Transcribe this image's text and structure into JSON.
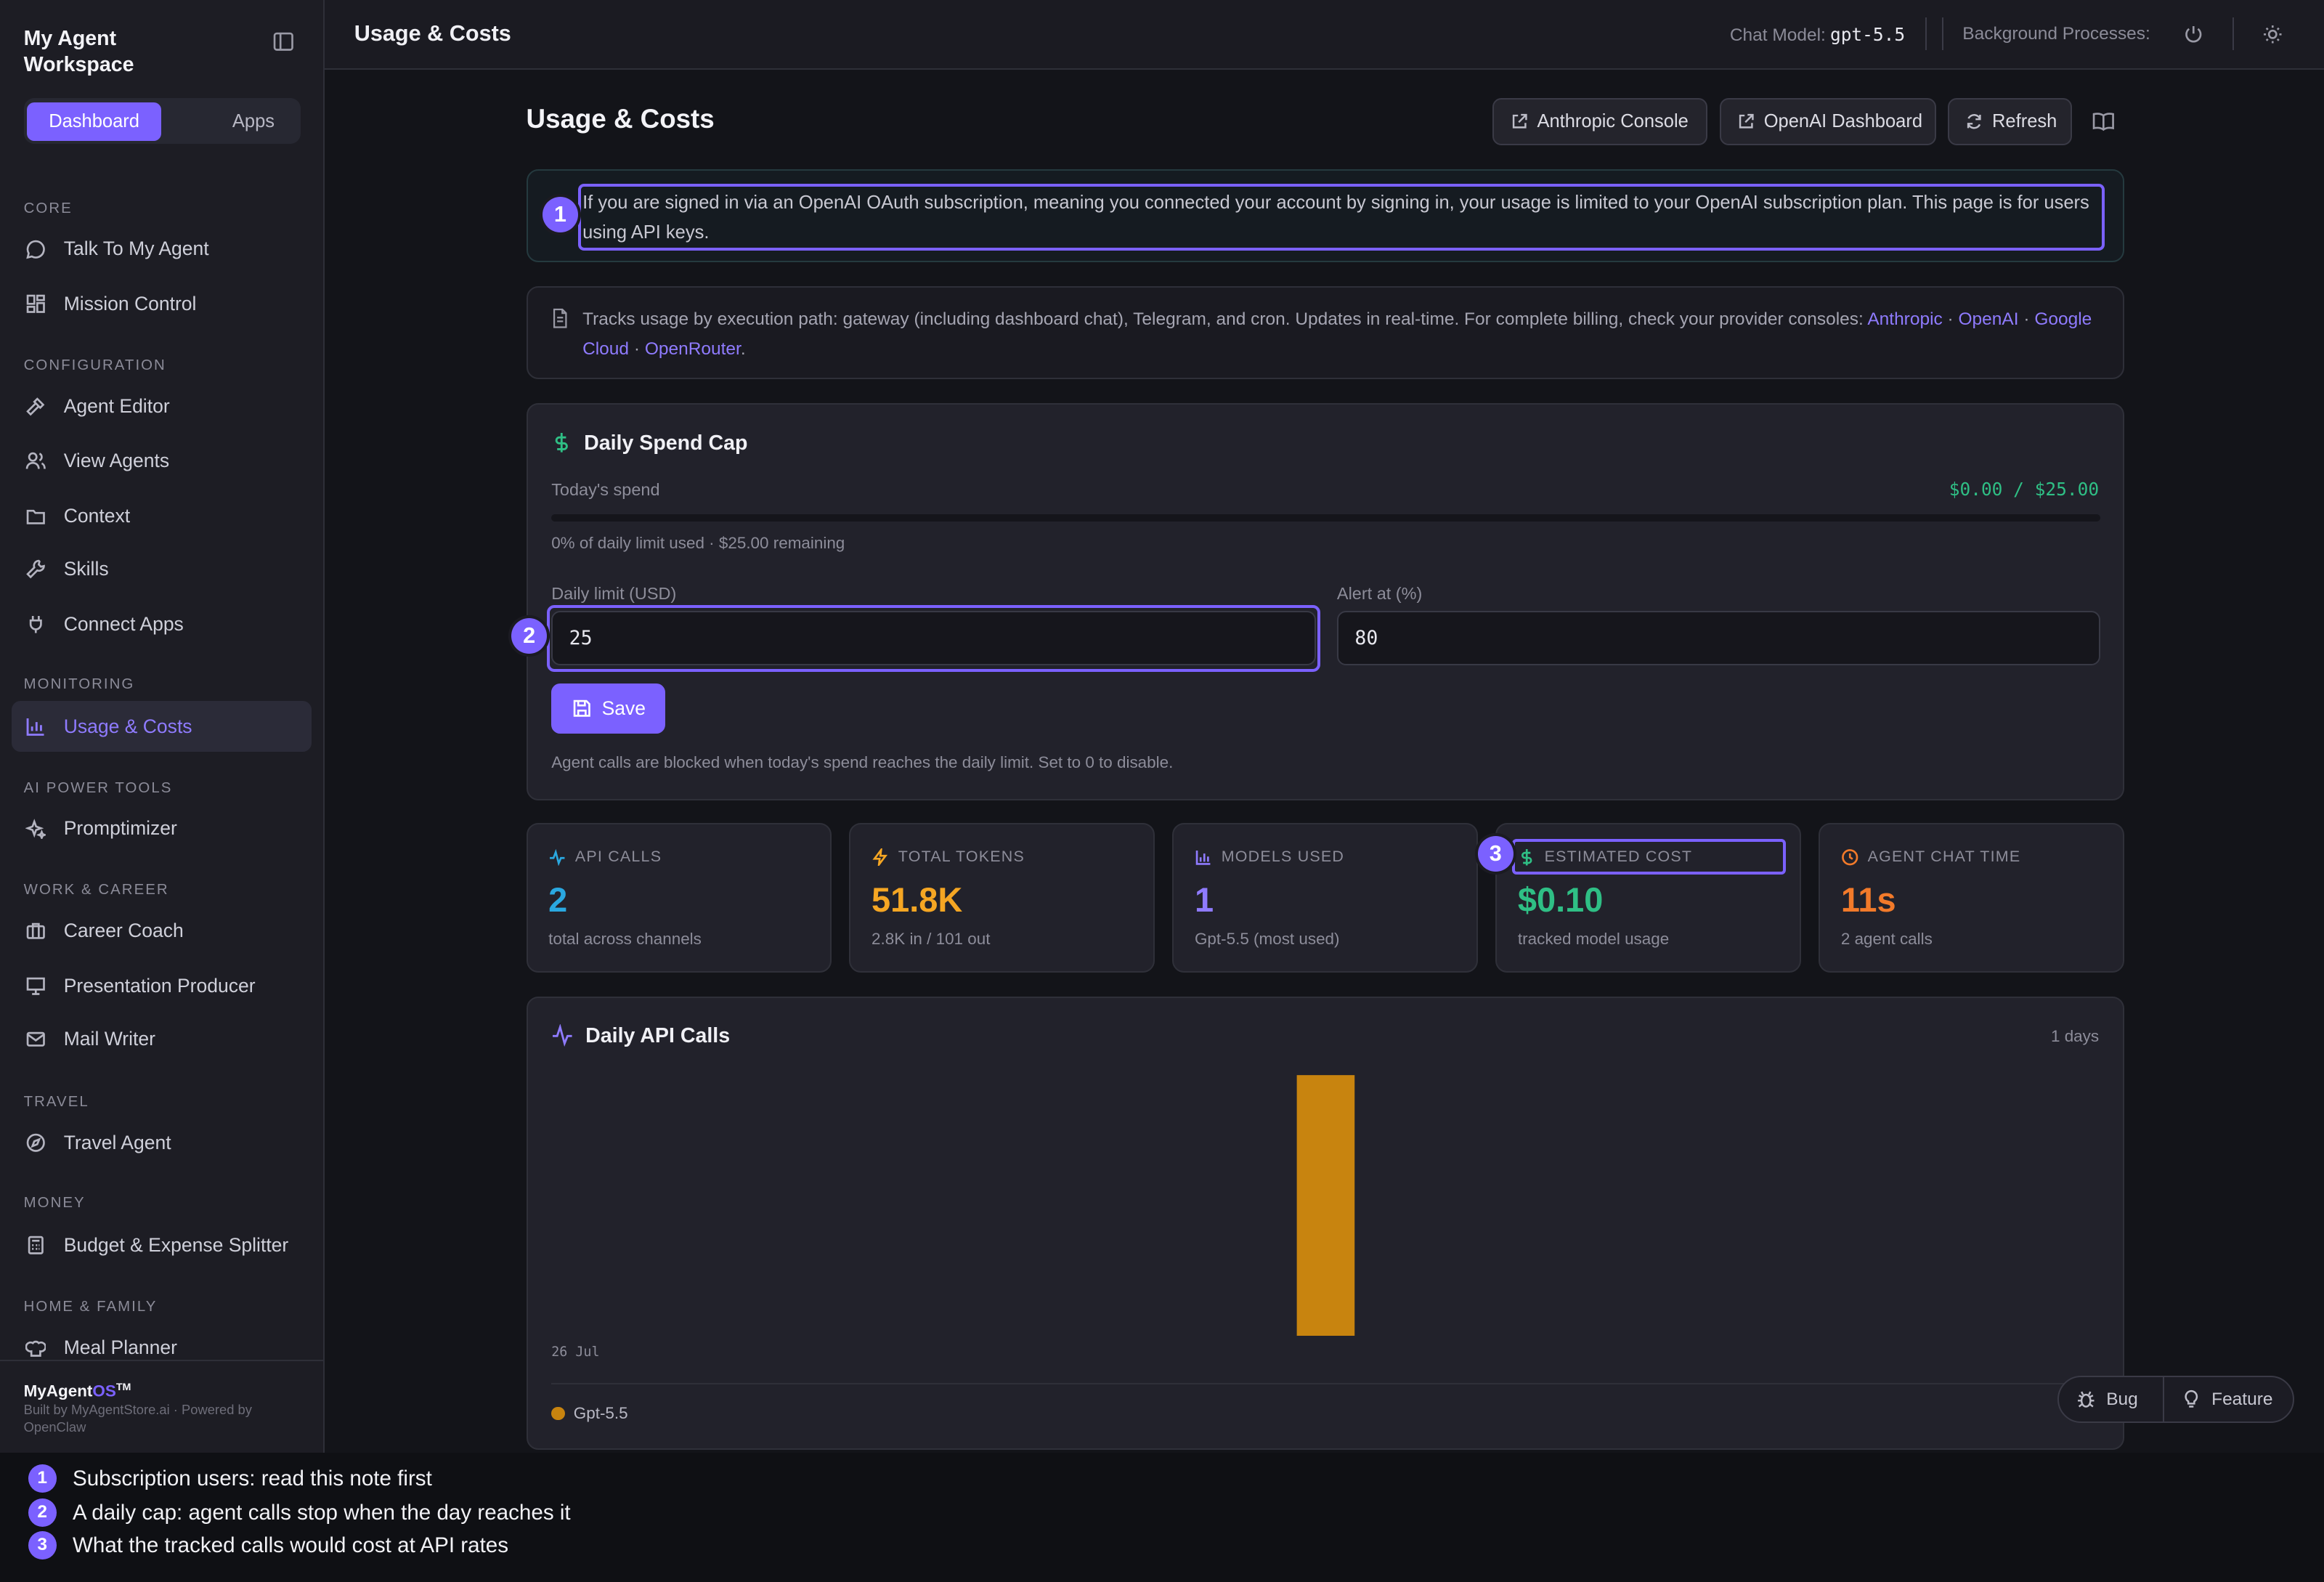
{
  "sidebar": {
    "workspace_title": "My Agent Workspace",
    "tabs": {
      "dashboard": "Dashboard",
      "apps": "Apps"
    },
    "sections": [
      {
        "label": "CORE"
      },
      {
        "label": "CONFIGURATION"
      },
      {
        "label": "MONITORING"
      },
      {
        "label": "AI POWER TOOLS"
      },
      {
        "label": "WORK & CAREER"
      },
      {
        "label": "TRAVEL"
      },
      {
        "label": "MONEY"
      },
      {
        "label": "HOME & FAMILY"
      }
    ],
    "items": [
      {
        "label": "Talk To My Agent",
        "icon": "chat-bubble-icon"
      },
      {
        "label": "Mission Control",
        "icon": "grid-icon"
      },
      {
        "label": "Agent Editor",
        "icon": "hammer-icon"
      },
      {
        "label": "View Agents",
        "icon": "users-icon"
      },
      {
        "label": "Context",
        "icon": "folder-icon"
      },
      {
        "label": "Skills",
        "icon": "wrench-icon"
      },
      {
        "label": "Connect Apps",
        "icon": "plug-icon"
      },
      {
        "label": "Usage & Costs",
        "icon": "bar-chart-icon",
        "active": true
      },
      {
        "label": "Promptimizer",
        "icon": "sparkles-icon"
      },
      {
        "label": "Career Coach",
        "icon": "briefcase-icon"
      },
      {
        "label": "Presentation Producer",
        "icon": "presentation-icon"
      },
      {
        "label": "Mail Writer",
        "icon": "mail-icon"
      },
      {
        "label": "Travel Agent",
        "icon": "compass-icon"
      },
      {
        "label": "Budget & Expense Splitter",
        "icon": "calculator-icon"
      },
      {
        "label": "Meal Planner",
        "icon": "chef-hat-icon"
      }
    ],
    "footer": {
      "brand_main": "MyAgent",
      "brand_os": "OS",
      "brand_tm": "TM",
      "built_by": "Built by MyAgentStore.ai · Powered by OpenClaw"
    }
  },
  "topbar": {
    "title": "Usage & Costs",
    "chat_model_label": "Chat Model:",
    "chat_model_value": "gpt-5.5",
    "background_label": "Background Processes:"
  },
  "main": {
    "title": "Usage & Costs",
    "buttons": {
      "anthropic": "Anthropic Console",
      "openai": "OpenAI Dashboard",
      "refresh": "Refresh"
    },
    "alert_text": "If you are signed in via an OpenAI OAuth subscription, meaning you connected your account by signing in, your usage is limited to your OpenAI subscription plan. This page is for users using API keys.",
    "info": {
      "text": "Tracks usage by execution path: gateway (including dashboard chat), Telegram, and cron. Updates in real-time. For complete billing, check your provider consoles: ",
      "links": [
        "Anthropic",
        "OpenAI",
        "Google Cloud",
        "OpenRouter"
      ],
      "separator": " · ",
      "end": "."
    },
    "spend_cap": {
      "title": "Daily Spend Cap",
      "today_label": "Today's spend",
      "today_value": "$0.00 / $25.00",
      "progress_fraction": 0,
      "pct_text": "0% of daily limit used · $25.00 remaining",
      "limit_label": "Daily limit (USD)",
      "limit_value": "25",
      "alert_label": "Alert at (%)",
      "alert_value": "80",
      "save_label": "Save",
      "note": "Agent calls are blocked when today's spend reaches the daily limit. Set to 0 to disable."
    },
    "stats": [
      {
        "label": "API CALLS",
        "value": "2",
        "sub": "total across channels",
        "color": "#2aa8e0",
        "icon": "activity-icon"
      },
      {
        "label": "TOTAL TOKENS",
        "value": "51.8K",
        "sub": "2.8K in / 101 out",
        "color": "#f5a623",
        "icon": "lightning-icon"
      },
      {
        "label": "MODELS USED",
        "value": "1",
        "sub": "Gpt-5.5 (most used)",
        "color": "#8f7bff",
        "icon": "bar-chart-icon"
      },
      {
        "label": "ESTIMATED COST",
        "value": "$0.10",
        "sub": "tracked model usage",
        "color": "#2fbf85",
        "icon": "dollar-icon"
      },
      {
        "label": "AGENT CHAT TIME",
        "value": "11s",
        "sub": "2 agent calls",
        "color": "#f27a2a",
        "icon": "clock-icon"
      }
    ]
  },
  "chart_data": {
    "type": "bar",
    "title": "Daily API Calls",
    "range_label": "1 days",
    "categories": [
      "26 Jul"
    ],
    "series": [
      {
        "name": "Gpt-5.5",
        "values": [
          2
        ],
        "color": "#c8840f"
      }
    ]
  },
  "feedback": {
    "bug": "Bug",
    "feature": "Feature"
  },
  "annotations": [
    {
      "n": "1",
      "text": "Subscription users: read this note first"
    },
    {
      "n": "2",
      "text": "A daily cap: agent calls stop when the day reaches it"
    },
    {
      "n": "3",
      "text": "What the tracked calls would cost at API rates"
    }
  ]
}
